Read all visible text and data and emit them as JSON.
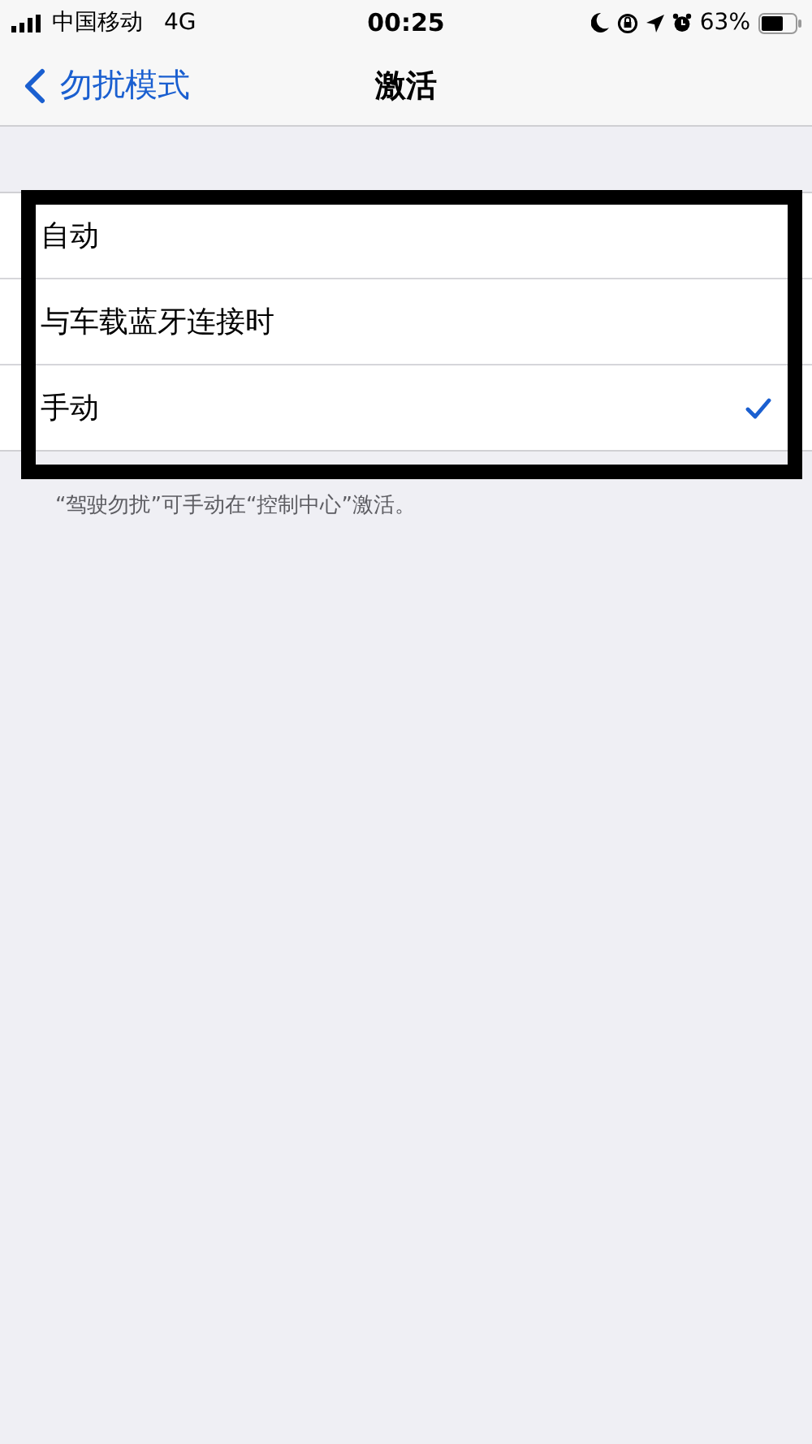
{
  "status_bar": {
    "carrier": "中国移动",
    "network": "4G",
    "time": "00:25",
    "battery": "63%"
  },
  "nav": {
    "back": "勿扰模式",
    "title": "激活"
  },
  "options": [
    {
      "label": "自动",
      "selected": false
    },
    {
      "label": "与车载蓝牙连接时",
      "selected": false
    },
    {
      "label": "手动",
      "selected": true
    }
  ],
  "footer": "“驾驶勿扰”可手动在“控制中心”激活。"
}
